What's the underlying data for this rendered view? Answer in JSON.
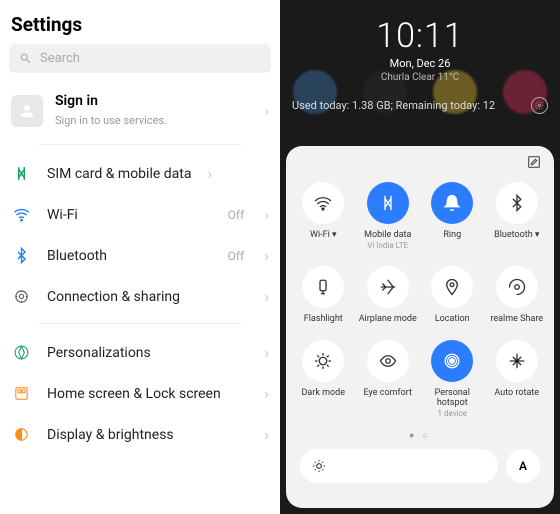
{
  "settings": {
    "title": "Settings",
    "search_placeholder": "Search",
    "signin": {
      "title": "Sign in",
      "subtitle": "Sign in to use services."
    },
    "items": [
      {
        "label": "SIM card & mobile data",
        "status": ""
      },
      {
        "label": "Wi-Fi",
        "status": "Off"
      },
      {
        "label": "Bluetooth",
        "status": "Off"
      },
      {
        "label": "Connection & sharing",
        "status": ""
      }
    ],
    "items2": [
      {
        "label": "Personalizations"
      },
      {
        "label": "Home screen & Lock screen"
      },
      {
        "label": "Display & brightness"
      }
    ]
  },
  "qs": {
    "time": "10:11",
    "date": "Mon, Dec 26",
    "weather": "Churla Clear 11°C",
    "data_usage": "Used today: 1.38 GB; Remaining today: 12",
    "tiles": [
      {
        "label": "Wi-Fi ▾",
        "sub": "",
        "active": false
      },
      {
        "label": "Mobile data",
        "sub": "Vi India LTE",
        "active": true
      },
      {
        "label": "Ring",
        "sub": "",
        "active": true
      },
      {
        "label": "Bluetooth ▾",
        "sub": "",
        "active": false
      },
      {
        "label": "Flashlight",
        "sub": "",
        "active": false
      },
      {
        "label": "Airplane mode",
        "sub": "",
        "active": false
      },
      {
        "label": "Location",
        "sub": "",
        "active": false
      },
      {
        "label": "realme Share",
        "sub": "",
        "active": false
      },
      {
        "label": "Dark mode",
        "sub": "",
        "active": false
      },
      {
        "label": "Eye comfort",
        "sub": "",
        "active": false
      },
      {
        "label": "Personal hotspot",
        "sub": "1 device",
        "active": true
      },
      {
        "label": "Auto rotate",
        "sub": "",
        "active": false
      }
    ],
    "auto_brightness": "A"
  }
}
